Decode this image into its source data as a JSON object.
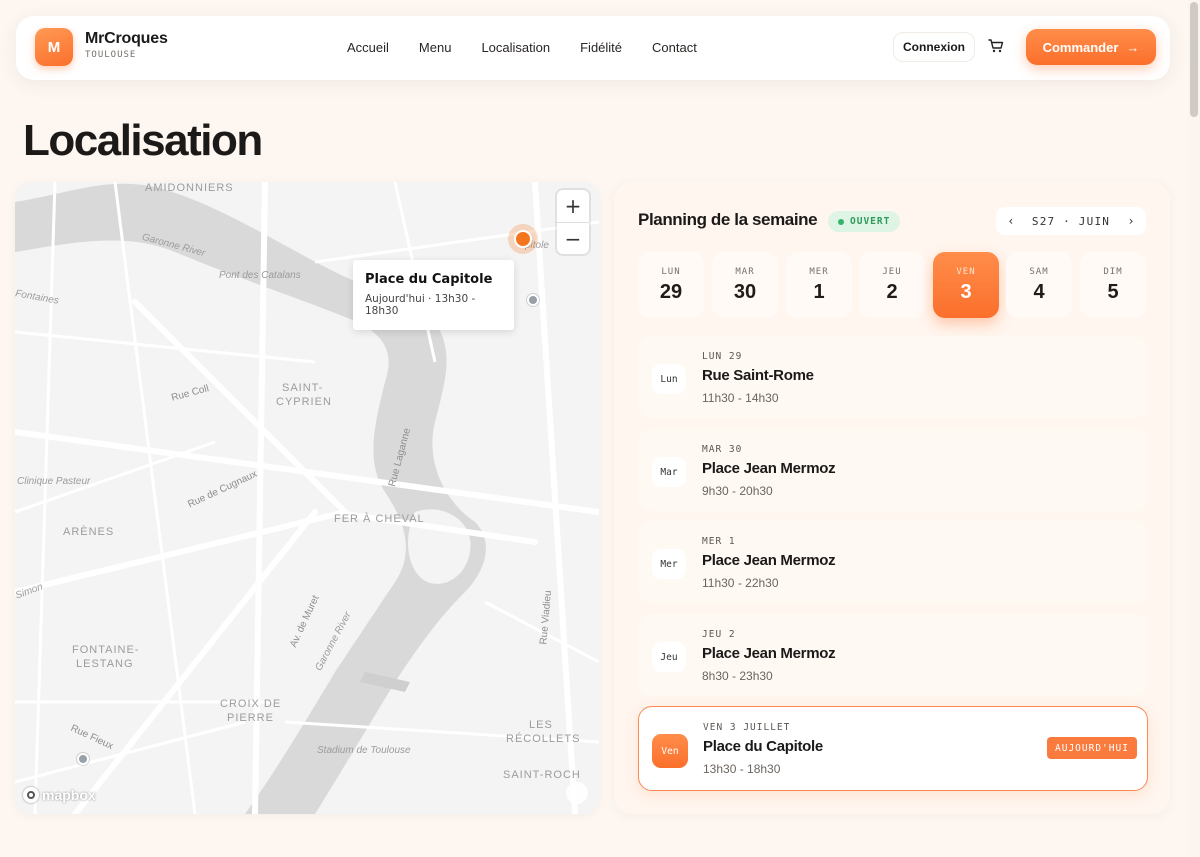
{
  "header": {
    "logo_letter": "M",
    "brand_name": "MrCroques",
    "brand_city": "TOULOUSE",
    "nav": [
      "Accueil",
      "Menu",
      "Localisation",
      "Fidélité",
      "Contact"
    ],
    "login_label": "Connexion",
    "order_label": "Commander",
    "order_arrow": "→"
  },
  "page": {
    "title": "Localisation"
  },
  "map": {
    "zoom_in": "+",
    "zoom_out": "−",
    "popup_title": "Place du Capitole",
    "popup_subtitle": "Aujourd'hui · 13h30 - 18h30",
    "attribution": "mapbox",
    "labels": {
      "amidonniers": "AMIDONNIERS",
      "garonne_river_top": "Garonne River",
      "pont_catalans": "Pont des Catalans",
      "fontaines": "Fontaines",
      "capitole_partial": "pitole",
      "rue_coll": "Rue Coll",
      "saint_cyprien_1": "SAINT-",
      "saint_cyprien_2": "CYPRIEN",
      "rue_laganne": "Rue Laganne",
      "clinique_pasteur": "Clinique Pasteur",
      "rue_cugnaux": "Rue de Cugnaux",
      "arenes": "ARÈNES",
      "fer_a_cheval": "FER À CHEVAL",
      "simon": "Simon",
      "av_muret": "Av. de Muret",
      "garonne_river_bottom": "Garonne River",
      "rue_viadieu": "Rue Viadieu",
      "fontaine_lestang_1": "FONTAINE-",
      "fontaine_lestang_2": "LESTANG",
      "croix_pierre_1": "CROIX DE",
      "croix_pierre_2": "PIERRE",
      "stadium": "Stadium de Toulouse",
      "recollets_1": "LES",
      "recollets_2": "RÉCOLLETS",
      "rue_fieux": "Rue Fieux",
      "saint_roch": "SAINT-ROCH"
    }
  },
  "planning": {
    "title": "Planning de la semaine",
    "status": "OUVERT",
    "week_label": "S27 · JUIN",
    "prev": "‹",
    "next": "›",
    "days": [
      {
        "name": "LUN",
        "num": "29"
      },
      {
        "name": "MAR",
        "num": "30"
      },
      {
        "name": "MER",
        "num": "1"
      },
      {
        "name": "JEU",
        "num": "2"
      },
      {
        "name": "VEN",
        "num": "3",
        "active": true
      },
      {
        "name": "SAM",
        "num": "4"
      },
      {
        "name": "DIM",
        "num": "5"
      }
    ],
    "slots": [
      {
        "badge": "Lun",
        "date": "LUN 29",
        "place": "Rue Saint-Rome",
        "hours": "11h30 - 14h30"
      },
      {
        "badge": "Mar",
        "date": "MAR 30",
        "place": "Place Jean Mermoz",
        "hours": "9h30 - 20h30"
      },
      {
        "badge": "Mer",
        "date": "MER 1",
        "place": "Place Jean Mermoz",
        "hours": "11h30 - 22h30"
      },
      {
        "badge": "Jeu",
        "date": "JEU 2",
        "place": "Place Jean Mermoz",
        "hours": "8h30 - 23h30"
      },
      {
        "badge": "Ven",
        "date": "VEN 3 JUILLET",
        "place": "Place du Capitole",
        "hours": "13h30 - 18h30",
        "today_label": "AUJOURD'HUI"
      }
    ]
  },
  "colors": {
    "accent": "#fb6f2c",
    "background": "#fdf6f1",
    "status_green": "#34b46a"
  }
}
